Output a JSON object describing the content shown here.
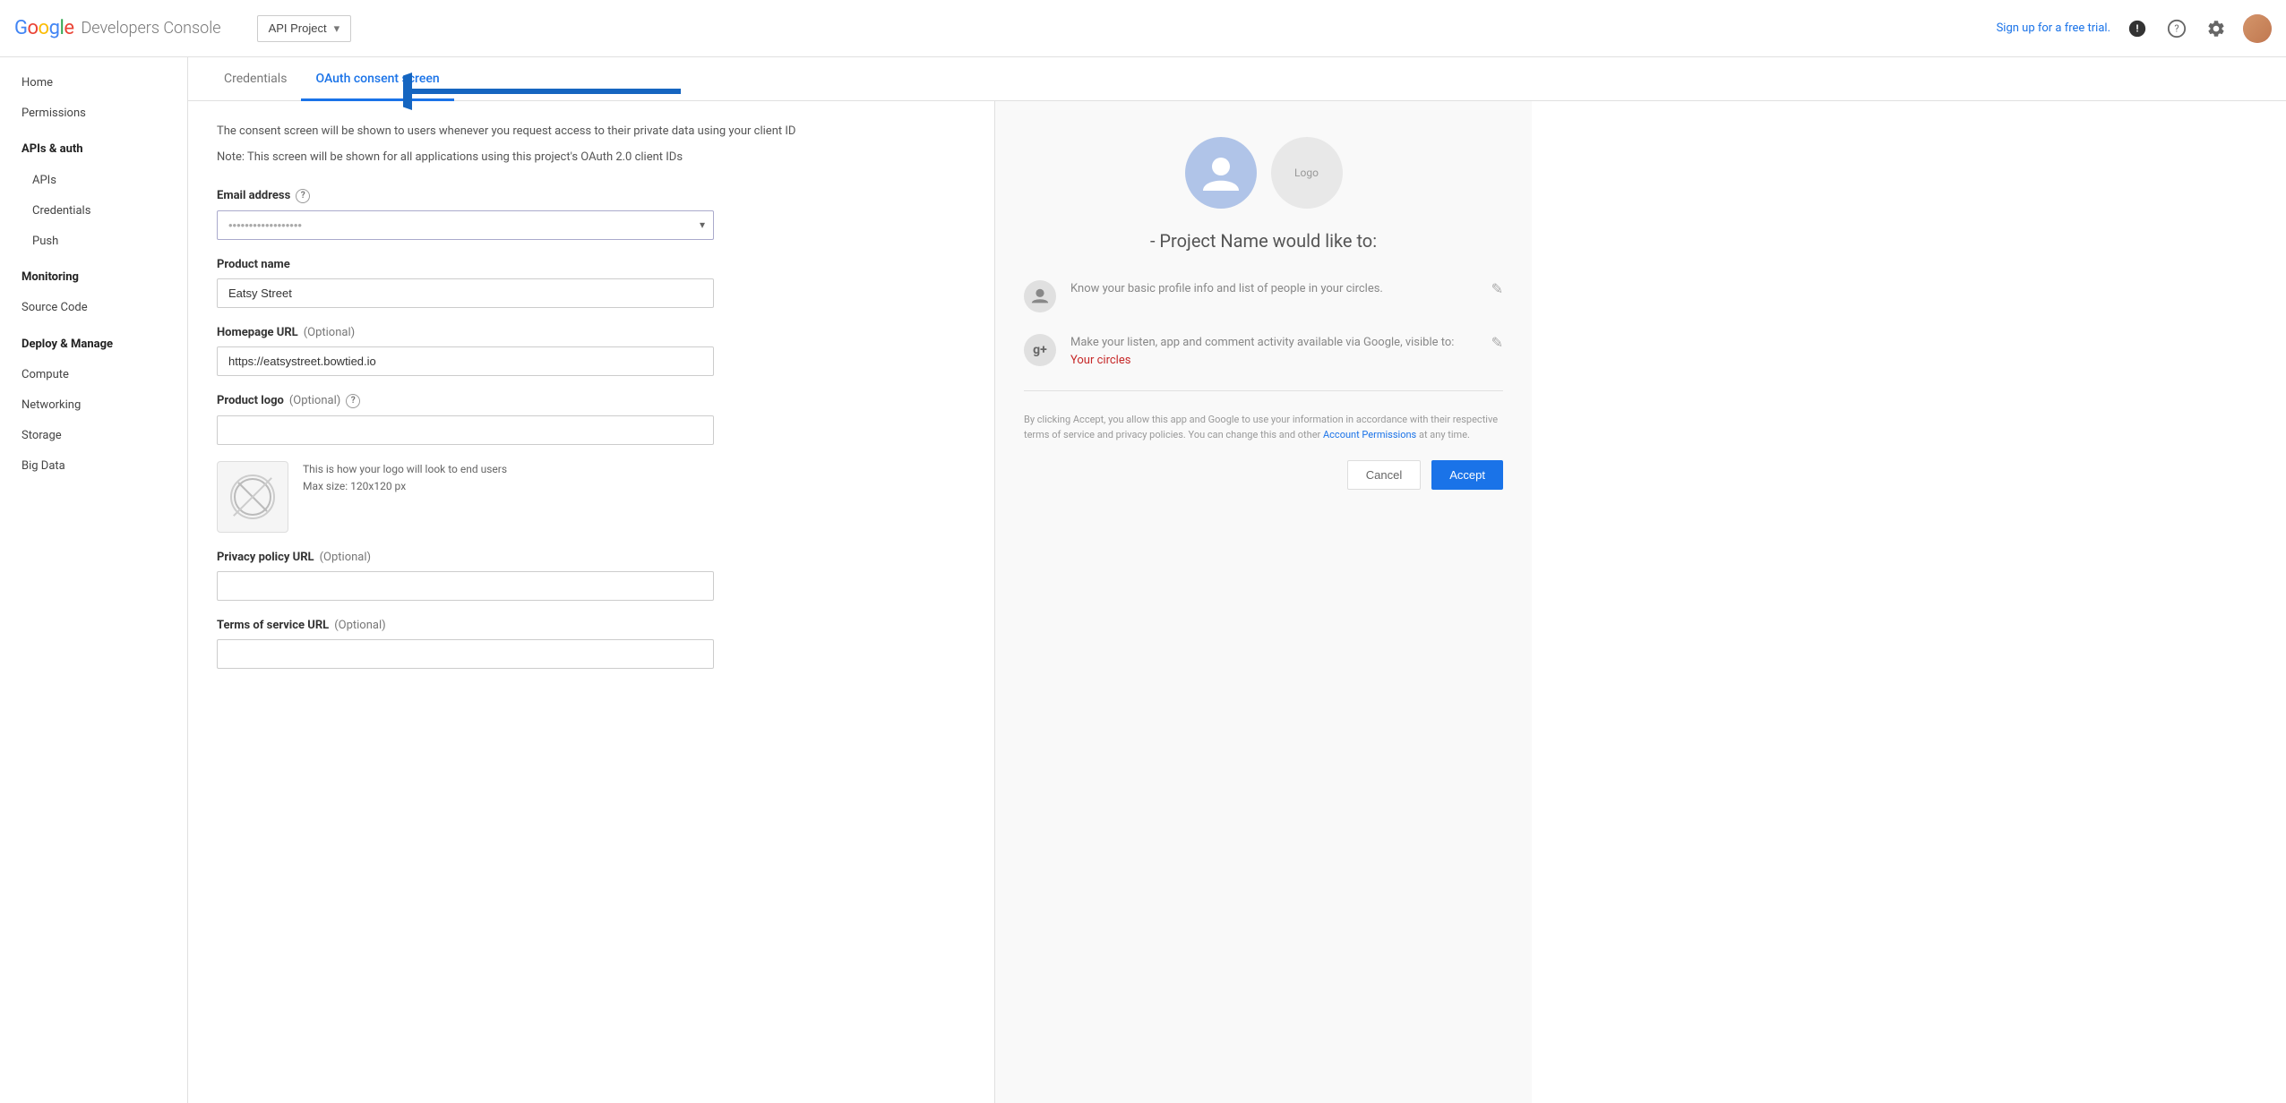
{
  "header": {
    "google_text": "Google",
    "app_name": "Developers Console",
    "project_name": "API Project",
    "free_trial_label": "Sign up for a free trial.",
    "alert_icon": "!",
    "help_icon": "?",
    "settings_icon": "⚙"
  },
  "sidebar": {
    "items": [
      {
        "id": "home",
        "label": "Home",
        "type": "normal"
      },
      {
        "id": "permissions",
        "label": "Permissions",
        "type": "normal"
      },
      {
        "id": "apis-auth",
        "label": "APIs & auth",
        "type": "bold"
      },
      {
        "id": "apis",
        "label": "APIs",
        "type": "sub"
      },
      {
        "id": "credentials",
        "label": "Credentials",
        "type": "sub"
      },
      {
        "id": "push",
        "label": "Push",
        "type": "sub"
      },
      {
        "id": "monitoring",
        "label": "Monitoring",
        "type": "bold"
      },
      {
        "id": "source-code",
        "label": "Source Code",
        "type": "normal"
      },
      {
        "id": "deploy-manage",
        "label": "Deploy & Manage",
        "type": "bold"
      },
      {
        "id": "compute",
        "label": "Compute",
        "type": "normal"
      },
      {
        "id": "networking",
        "label": "Networking",
        "type": "normal"
      },
      {
        "id": "storage",
        "label": "Storage",
        "type": "normal"
      },
      {
        "id": "big-data",
        "label": "Big Data",
        "type": "normal"
      }
    ]
  },
  "tabs": [
    {
      "id": "credentials",
      "label": "Credentials",
      "active": false
    },
    {
      "id": "oauth-consent",
      "label": "OAuth consent screen",
      "active": true
    }
  ],
  "form": {
    "description": "The consent screen will be shown to users whenever you request access to their private data using your client ID",
    "note": "Note: This screen will be shown for all applications using this project's OAuth 2.0 client IDs",
    "email_label": "Email address",
    "email_placeholder": "••••••••••••••••••",
    "email_value": "",
    "product_name_label": "Product name",
    "product_name_value": "Eatsy Street",
    "homepage_label": "Homepage URL",
    "homepage_optional": "(Optional)",
    "homepage_value": "https://eatsystreet.bowtied.io",
    "product_logo_label": "Product logo",
    "product_logo_optional": "(Optional)",
    "logo_hint_line1": "This is how your logo will look to end users",
    "logo_hint_line2": "Max size: 120x120 px",
    "privacy_policy_label": "Privacy policy URL",
    "privacy_policy_optional": "(Optional)",
    "privacy_policy_value": "",
    "terms_label": "Terms of service URL",
    "terms_optional": "(Optional)",
    "terms_value": ""
  },
  "preview": {
    "project_name_text": "- Project Name would like to:",
    "logo_placeholder": "Logo",
    "perm1_text": "Know your basic profile info and list of people in your circles.",
    "perm2_text1": "Make your listen, app and comment activity available via Google, visible to:",
    "perm2_link": "Your circles",
    "accept_notice": "By clicking Accept, you allow this app and Google to use your information in accordance with their respective terms of service and privacy policies. You can change this and other ",
    "account_permissions_link": "Account Permissions",
    "accept_notice_end": " at any time.",
    "cancel_label": "Cancel",
    "accept_label": "Accept"
  }
}
